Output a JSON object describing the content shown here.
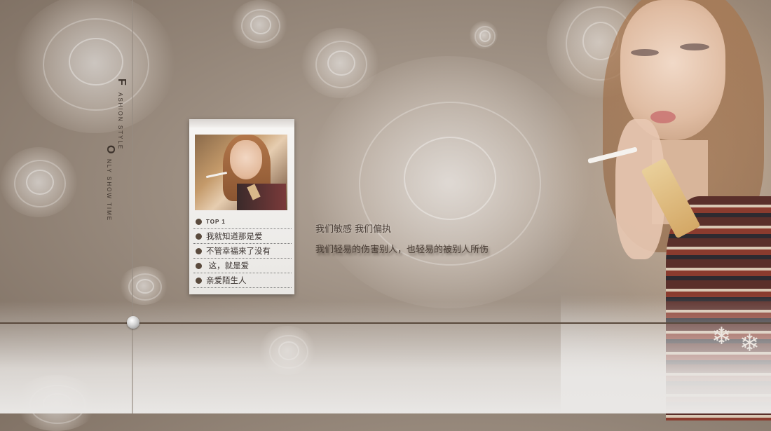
{
  "sidebar_text": {
    "fashion_initial": "F",
    "fashion_rest": "ASHION STYLE",
    "only_initial": "O",
    "only_rest": "NLY SHOW TIME"
  },
  "card": {
    "header": "TOP 1",
    "items": [
      {
        "label": "我就知道那是爱"
      },
      {
        "label": "不管幸福来了没有"
      },
      {
        "label": " 这，就是爱"
      },
      {
        "label": "亲爱陌生人"
      }
    ]
  },
  "quotes": {
    "line1": "我们敏感 我们偏执",
    "line2": "我们轻易的伤害别人，也轻易的被别人所伤"
  },
  "colors": {
    "background": "#9b8d80",
    "divider": "#5a4a3d",
    "text": "#4a3e36"
  }
}
